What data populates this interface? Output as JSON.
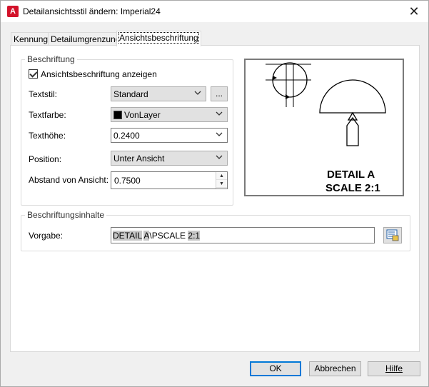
{
  "window": {
    "title": "Detailansichtsstil ändern: Imperial24",
    "app_icon": "A",
    "close_symbol": "✕"
  },
  "tabs": [
    {
      "label": "Kennung"
    },
    {
      "label": "Detailumgrenzung"
    },
    {
      "label": "Ansichtsbeschriftung"
    }
  ],
  "beschriftung": {
    "group_label": "Beschriftung",
    "show_label_checkbox": {
      "label": "Ansichtsbeschriftung anzeigen",
      "checked": true
    },
    "textstil": {
      "label": "Textstil:",
      "value": "Standard",
      "browse_label": "..."
    },
    "textfarbe": {
      "label": "Textfarbe:",
      "value": "VonLayer",
      "swatch_color": "#000000"
    },
    "texthoehe": {
      "label": "Texthöhe:",
      "value": "0.2400"
    },
    "position": {
      "label": "Position:",
      "value": "Unter Ansicht"
    },
    "abstand": {
      "label": "Abstand von Ansicht:",
      "value": "0.7500"
    }
  },
  "preview": {
    "line1": "DETAIL A",
    "line2": "SCALE 2:1"
  },
  "inhalte": {
    "group_label": "Beschriftungsinhalte",
    "vorgabe_label": "Vorgabe:",
    "vorgabe_parts": [
      "DETAIL",
      " ",
      "A",
      "\\PSCALE ",
      "2:1"
    ]
  },
  "footer": {
    "ok": "OK",
    "cancel": "Abbrechen",
    "help": "Hilfe"
  }
}
